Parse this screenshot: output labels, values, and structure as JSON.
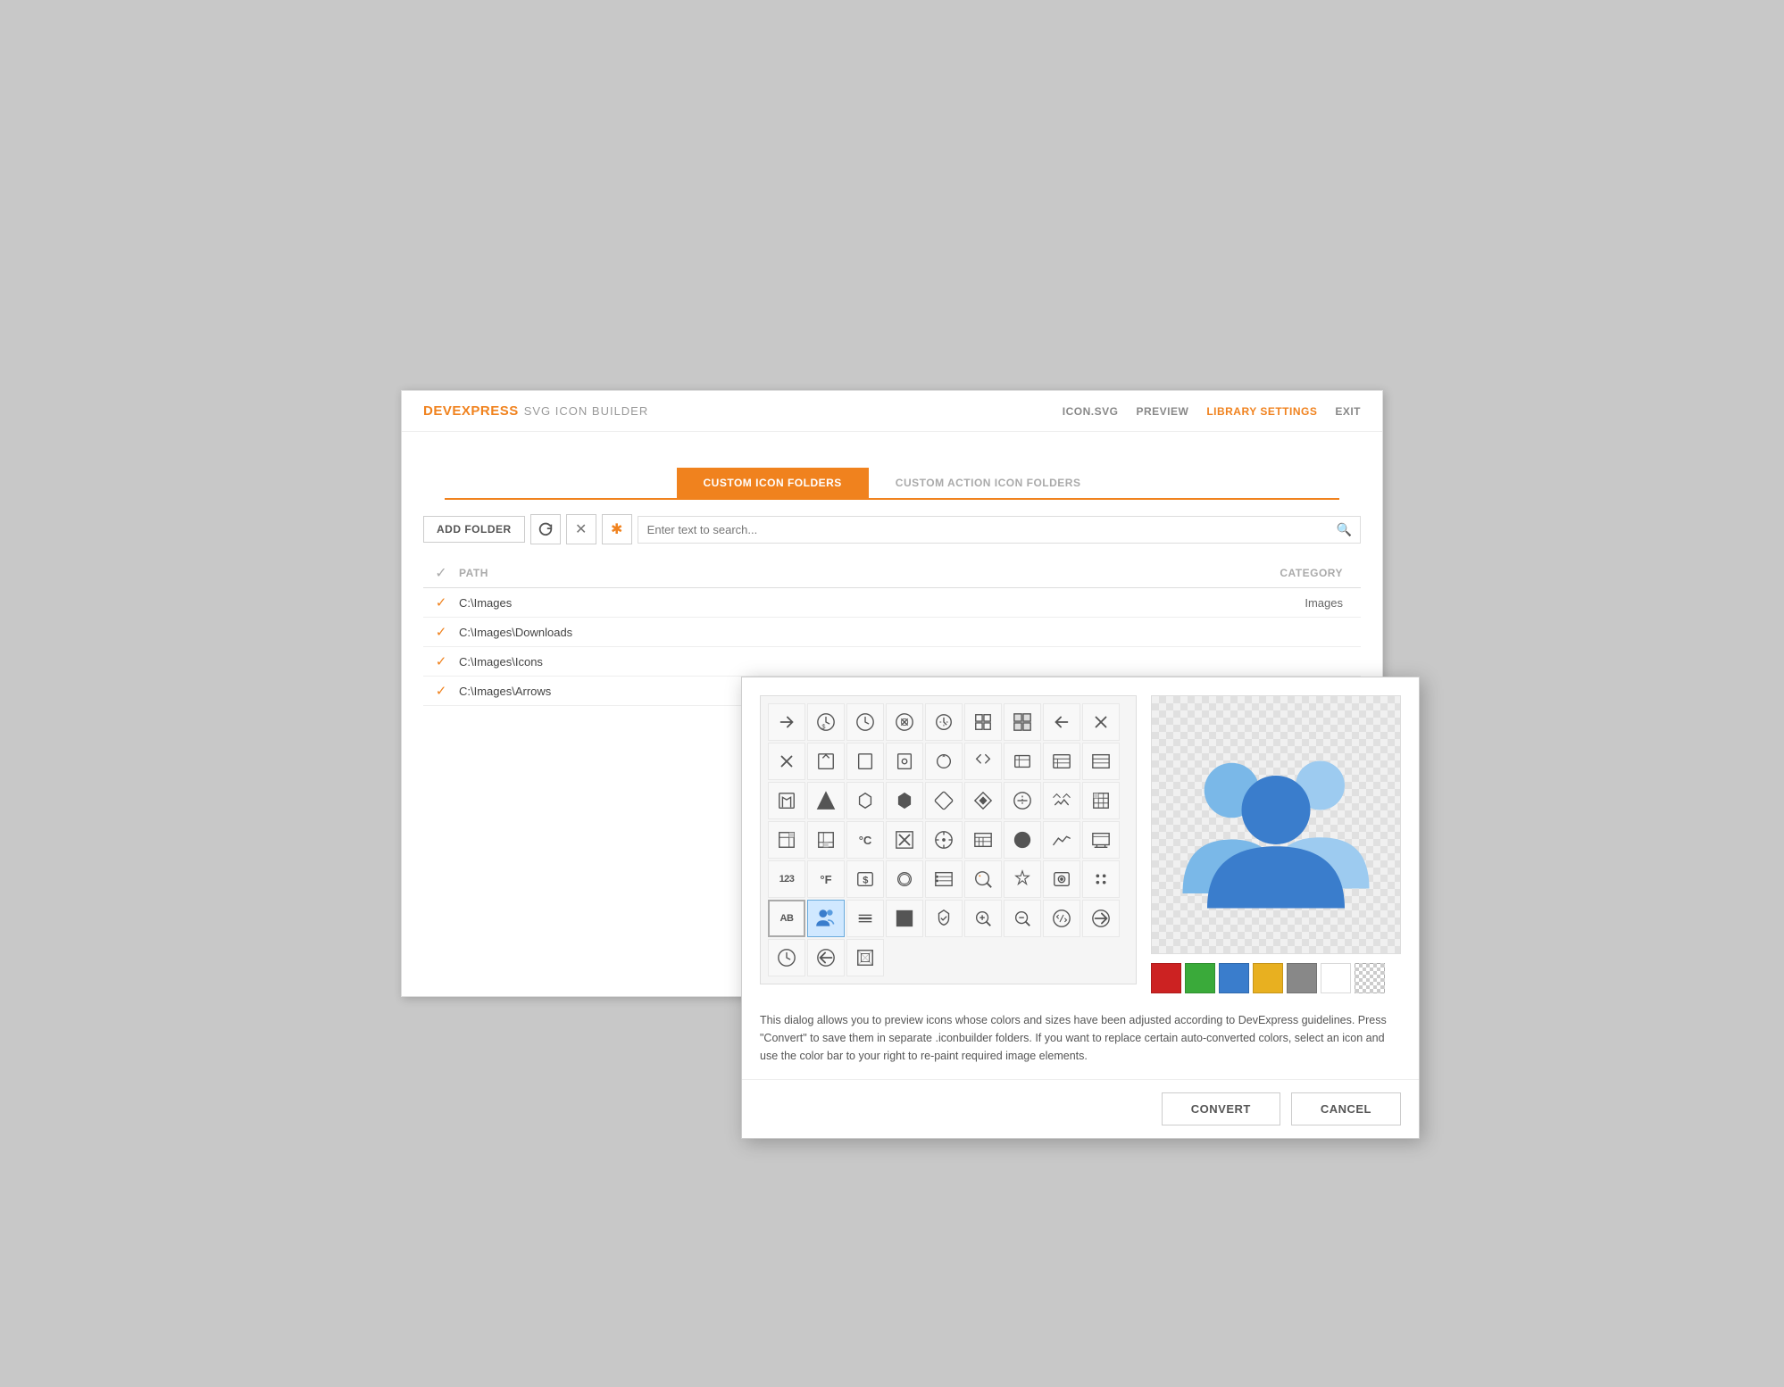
{
  "app": {
    "logo_brand": "DEVEXPRESS",
    "logo_subtitle": "SVG ICON BUILDER"
  },
  "header": {
    "nav": [
      {
        "id": "icon-svg",
        "label": "ICON.SVG"
      },
      {
        "id": "preview",
        "label": "PREVIEW"
      },
      {
        "id": "library-settings",
        "label": "LIBRARY SETTINGS",
        "active": true
      },
      {
        "id": "exit",
        "label": "EXIT"
      }
    ]
  },
  "tabs": [
    {
      "id": "custom-icon-folders",
      "label": "CUSTOM ICON FOLDERS",
      "active": true
    },
    {
      "id": "custom-action-icon-folders",
      "label": "CUSTOM ACTION ICON FOLDERS",
      "active": false
    }
  ],
  "toolbar": {
    "add_folder_label": "ADD FOLDER",
    "search_placeholder": "Enter text to search..."
  },
  "table": {
    "col_path": "PATH",
    "col_category": "CATEGORY",
    "rows": [
      {
        "path": "C:\\Images",
        "category": "Images"
      },
      {
        "path": "C:\\Images\\Downloads",
        "category": ""
      },
      {
        "path": "C:\\Images\\Icons",
        "category": ""
      },
      {
        "path": "C:\\Images\\Arrows",
        "category": ""
      }
    ]
  },
  "dialog": {
    "description": "This dialog allows you to preview icons whose colors and sizes have been adjusted according to DevExpress guidelines. Press \"Convert\" to save them in separate .iconbuilder folders. If you want to replace certain auto-converted colors, select an icon and use the color bar to your right to re-paint required image elements.",
    "colors": [
      {
        "id": "red",
        "hex": "#cc2222"
      },
      {
        "id": "green",
        "hex": "#3aaa3a"
      },
      {
        "id": "blue",
        "hex": "#3a7dcc"
      },
      {
        "id": "yellow",
        "hex": "#e8b020"
      },
      {
        "id": "gray",
        "hex": "#888888"
      },
      {
        "id": "white",
        "hex": "#ffffff"
      },
      {
        "id": "transparent",
        "hex": "transparent"
      }
    ],
    "convert_label": "CONVERT",
    "cancel_label": "CANCEL"
  },
  "icons": [
    "➜",
    "💲",
    "🕐",
    "⚙",
    "⚙",
    "▦",
    "▦",
    "↩",
    "✕",
    "✧",
    "📄",
    "🔍",
    "↺",
    "↩",
    "💾",
    "▦",
    "📄",
    "♦",
    "▲",
    "⬡",
    "⬡",
    "✧",
    "▶",
    "🧭",
    "⚙",
    "▣",
    "▣",
    "▣",
    "°C",
    "✕",
    "⊕",
    "▤",
    "●",
    "📈",
    "⏩",
    "123",
    "°F",
    "$",
    "⊙",
    "▤",
    "🔍",
    "✧",
    "📷",
    "✦",
    "AB",
    "👥",
    "⊟",
    "■",
    "⚑",
    "🔍",
    "🔍",
    "🧭",
    "➜",
    "🕐",
    "↩",
    "⊙"
  ]
}
